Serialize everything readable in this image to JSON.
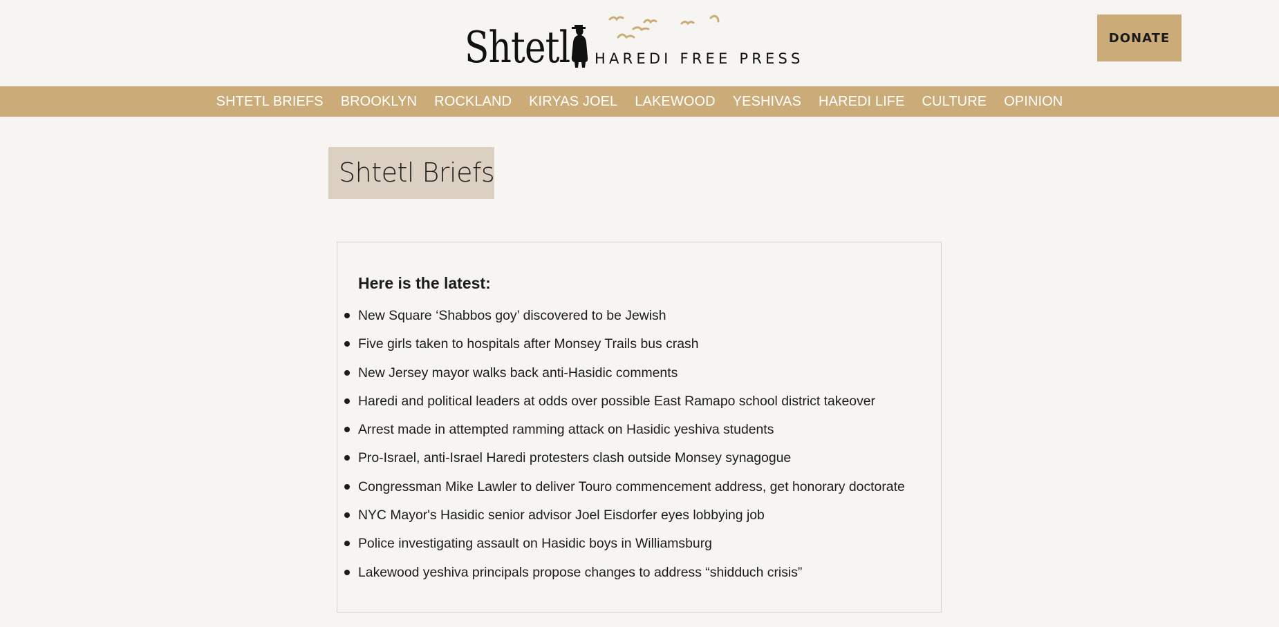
{
  "header": {
    "logo": {
      "wordmark": "Shtetl",
      "tagline": "HAREDI FREE PRESS"
    },
    "donate_label": "DONATE"
  },
  "nav": {
    "items": [
      {
        "label": "SHTETL BRIEFS"
      },
      {
        "label": "BROOKLYN"
      },
      {
        "label": "ROCKLAND"
      },
      {
        "label": "KIRYAS JOEL"
      },
      {
        "label": "LAKEWOOD"
      },
      {
        "label": "YESHIVAS"
      },
      {
        "label": "HAREDI LIFE"
      },
      {
        "label": "CULTURE"
      },
      {
        "label": "OPINION"
      }
    ]
  },
  "page": {
    "title": "Shtetl Briefs",
    "briefs_heading": "Here is the latest:",
    "briefs": [
      "New Square ‘Shabbos goy’ discovered to be Jewish",
      "Five girls taken to hospitals after Monsey Trails bus crash",
      "New Jersey mayor walks back anti-Hasidic comments",
      "Haredi and political leaders at odds over possible East Ramapo school district takeover",
      "Arrest made in attempted ramming attack on Hasidic yeshiva students",
      "Pro-Israel, anti-Israel Haredi protesters clash outside Monsey synagogue",
      "Congressman Mike Lawler to deliver Touro commencement address, get honorary doctorate",
      "NYC Mayor's Hasidic senior advisor Joel Eisdorfer eyes lobbying job",
      "Police investigating assault on Hasidic boys in Williamsburg",
      "Lakewood yeshiva principals propose changes to address “shidduch crisis”"
    ]
  },
  "colors": {
    "accent": "#cbac78",
    "background": "#f6f5f1",
    "title_background": "#dbd0c1",
    "text": "#1b1b1b"
  },
  "icons": {
    "logo_figure": "hasidic-man-silhouette-icon",
    "logo_birds": "flying-birds-icon"
  }
}
